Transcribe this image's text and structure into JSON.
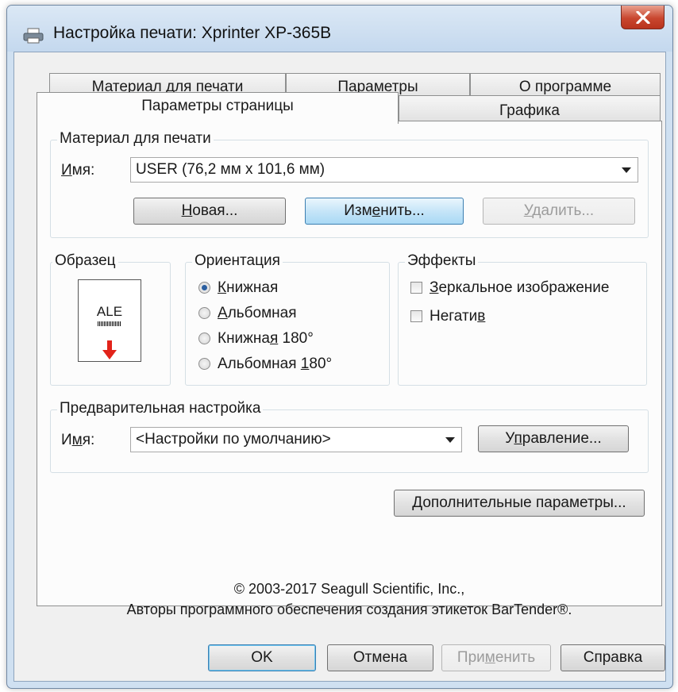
{
  "window": {
    "title": "Настройка печати: Xprinter XP-365B",
    "close_glyph": "X"
  },
  "tabs": {
    "row1": [
      "Материал для печати",
      "Параметры",
      "О программе"
    ],
    "row2": [
      "Параметры страницы",
      "Графика"
    ],
    "active": "Параметры страницы"
  },
  "material": {
    "group_title": "Материал для печати",
    "name_label_u": "И",
    "name_label_rest": "мя:",
    "name_value": "USER (76,2 мм x 101,6 мм)",
    "new_button_u": "Н",
    "new_button_rest": "овая...",
    "edit_button_pre": "Изм",
    "edit_button_u": "е",
    "edit_button_rest": "нить...",
    "delete_button_u": "У",
    "delete_button_rest": "далить..."
  },
  "sample": {
    "group_title": "Образец",
    "card_text": "ALE"
  },
  "orientation": {
    "group_title": "Ориентация",
    "options": [
      {
        "u": "К",
        "rest": "нижная",
        "selected": true
      },
      {
        "u": "А",
        "rest": "льбомная",
        "selected": false
      },
      {
        "pre": "Книжна",
        "u": "я",
        "rest": " 180°",
        "selected": false
      },
      {
        "pre": "Альбомная ",
        "u": "1",
        "rest": "80°",
        "selected": false
      }
    ]
  },
  "effects": {
    "group_title": "Эффекты",
    "mirror_u": "З",
    "mirror_rest": "еркальное изображение",
    "negative_pre": "Негати",
    "negative_u": "в",
    "mirror_checked": false,
    "negative_checked": false
  },
  "preset": {
    "group_title": "Предварительная настройка",
    "name_label_pre": "И",
    "name_label_u": "м",
    "name_label_rest": "я:",
    "value": "<Настройки по умолчанию>",
    "manage_pre": "У",
    "manage_u": "п",
    "manage_rest": "равление..."
  },
  "advanced_button_u": "Д",
  "advanced_button_rest": "ополнительные параметры...",
  "copyright": {
    "line1": "© 2003-2017 Seagull Scientific, Inc.,",
    "line2": "Авторы программного обеспечения создания этикеток BarTender®."
  },
  "footer": {
    "ok": "OK",
    "cancel": "Отмена",
    "apply_pre": "При",
    "apply_u": "м",
    "apply_rest": "енить",
    "help": "Справка"
  },
  "colors": {
    "frame": "#cfe0f1",
    "close": "#c9472f",
    "hot_button": "#c6e5f8",
    "arrow": "#e2231a"
  }
}
